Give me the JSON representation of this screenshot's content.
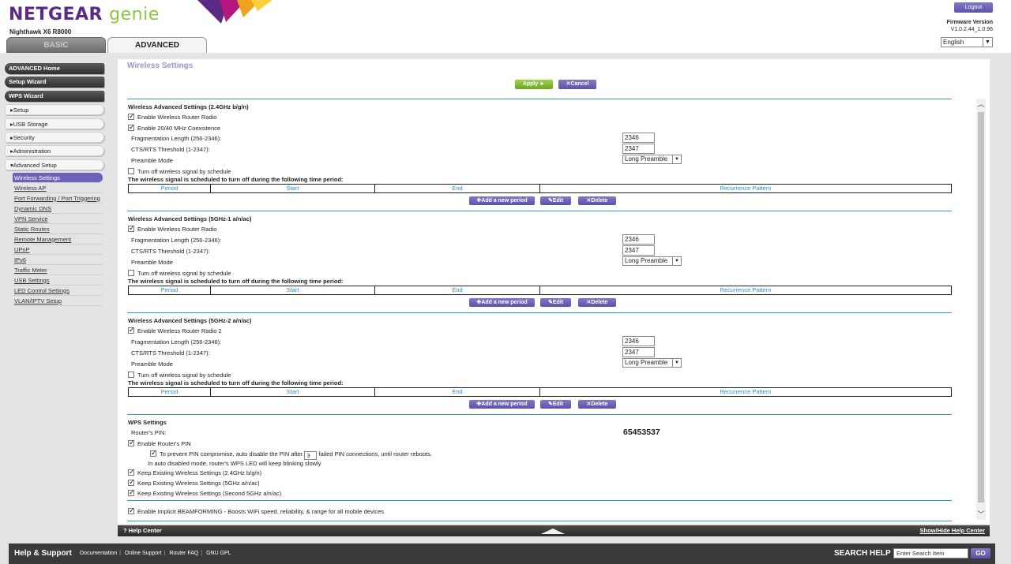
{
  "header": {
    "logo_main": "NETGEAR",
    "logo_sub": "genie",
    "model": "Nighthawk X6 R8000",
    "logout": "Logout",
    "firmware_label": "Firmware Version",
    "firmware_value": "V1.0.2.44_1.0.96",
    "language": "English",
    "tabs": [
      "BASIC",
      "ADVANCED"
    ]
  },
  "sidebar": {
    "main": [
      "ADVANCED Home",
      "Setup Wizard",
      "WPS Wizard"
    ],
    "sections": [
      "Setup",
      "USB Storage",
      "Security",
      "Administration",
      "Advanced Setup"
    ],
    "sub_items": [
      "Wireless Settings",
      "Wireless AP",
      "Port Forwarding / Port Triggering",
      "Dynamic DNS",
      "VPN Service",
      "Static Routes",
      "Remote Management",
      "UPnP",
      "IPv6",
      "Traffic Meter",
      "USB Settings",
      "LED Control Settings",
      "VLAN/IPTV Setup"
    ]
  },
  "page": {
    "title": "Wireless Settings",
    "apply": "Apply ►",
    "cancel": "Cancel"
  },
  "labels": {
    "frag": "Fragmentation Length (256-2346):",
    "cts": "CTS/RTS Threshold (1-2347):",
    "preamble": "Preamble Mode",
    "schedule_off": "Turn off wireless signal by schedule",
    "schedule_note": "The wireless signal is scheduled to turn off during the following time period:",
    "col_period": "Period",
    "col_start": "Start",
    "col_end": "End",
    "col_recurrence": "Recurrence Pattern",
    "add": "Add a new period",
    "edit": "Edit",
    "delete": "Delete"
  },
  "sections": [
    {
      "title": "Wireless Advanced Settings (2.4GHz b/g/n)",
      "radio": "Enable Wireless Router Radio",
      "coexist": "Enable 20/40 MHz Coexistence",
      "frag": "2346",
      "cts": "2347",
      "preamble": "Long Preamble"
    },
    {
      "title": "Wireless Advanced Settings (5GHz-1 a/n/ac)",
      "radio": "Enable Wireless Router Radio",
      "frag": "2346",
      "cts": "2347",
      "preamble": "Long Preamble"
    },
    {
      "title": "Wireless Advanced Settings (5GHz-2 a/n/ac)",
      "radio": "Enable Wireless Router Radio 2",
      "frag": "2346",
      "cts": "2347",
      "preamble": "Long Preamble"
    }
  ],
  "wps": {
    "title": "WPS Settings",
    "pin_label": "Router's PIN:",
    "pin_value": "65453537",
    "enable_pin": "Enable Router's PIN",
    "prevent_pre": "To prevent PIN compromise, auto disable the PIN after",
    "prevent_count": "3",
    "prevent_post": "failed PIN connections, until router reboots.",
    "auto_disabled_note": "In auto disabled mode, router's WPS LED will keep blinking slowly",
    "keep_24": "Keep Existing Wireless Settings (2.4GHz b/g/n)",
    "keep_5": "Keep Existing Wireless Settings (5GHz a/n/ac)",
    "keep_5b": "Keep Existing Wireless Settings (Second 5GHz a/n/ac)"
  },
  "beamforming": "Enable Implicit BEAMFORMING - Boosts WiFi speed, reliability, & range for all mobile devices",
  "helpbar": {
    "left": "Help Center",
    "right": "Show/Hide Help Center"
  },
  "footer": {
    "help_support": "Help & Support",
    "links": [
      "Documentation",
      "Online Support",
      "Router FAQ",
      "GNU GPL"
    ],
    "search_label": "SEARCH HELP",
    "search_placeholder": "Enter Search Item",
    "go": "GO"
  }
}
